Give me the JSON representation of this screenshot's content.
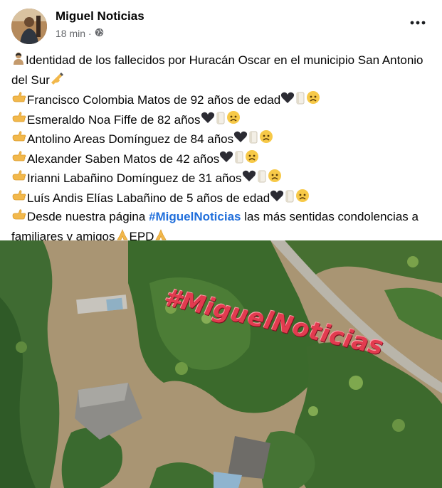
{
  "post": {
    "author": "Miguel Noticias",
    "time": "18 min",
    "separator": "·",
    "lines": {
      "intro": "Identidad de los fallecidos por Huracán Oscar en el municipio San Antonio del Sur",
      "v1": "Francisco Colombia Matos de 92 años de edad",
      "v2": "Esmeraldo Noa Fiffe de 82 años",
      "v3": "Antolino Areas Domínguez de 84 años",
      "v4": "Alexander Saben Matos de 42 años",
      "v5": "Irianni Labañino Domínguez de 31 años",
      "v6": "Luís Andis Elías Labañino de 5 años de edad",
      "closing_a": "Desde nuestra página ",
      "hashtag": "#MiguelNoticias",
      "closing_b": " las más sentidas condolencias a familiares y amigos",
      "epd": "EPD"
    }
  },
  "photo": {
    "watermark": "#MiguelNoticias",
    "description_icon": "aerial-flood-photo"
  },
  "icons": {
    "privacy": "globe-icon",
    "more": "more-options-icon",
    "bullet": "pointing-hand-icon",
    "heart": "black-heart-icon",
    "candle": "candle-icon",
    "sad": "sad-face-icon"
  },
  "colors": {
    "hashtag": "#216fdb",
    "meta": "#65676b",
    "watermark": "#e23b4f"
  }
}
